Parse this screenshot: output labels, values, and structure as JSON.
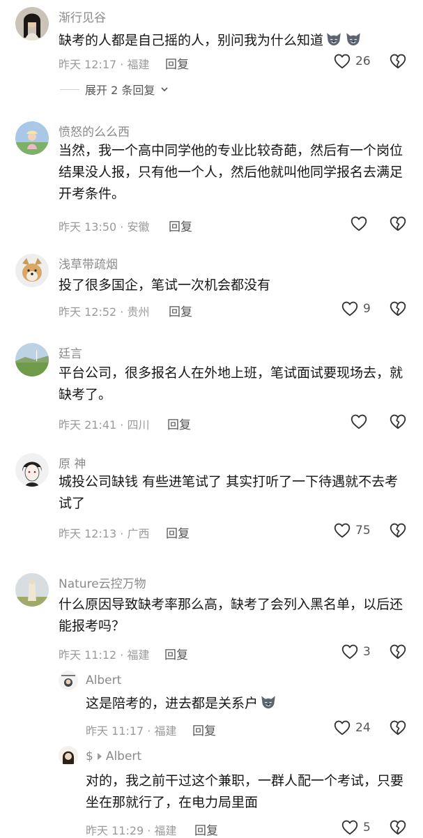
{
  "comments": [
    {
      "name": "渐行见谷",
      "text": "缺考的人都是自己摇的人，别问我为什么知道",
      "meta": "昨天 12:17 · 福建",
      "reply": "回复",
      "likes": "26",
      "expand": "展开 2 条回复"
    },
    {
      "name": "愤怒的么么西",
      "text": "当然，我一个高中同学他的专业比较奇葩，然后有一个岗位结果没人报，只有他一个人，然后他就叫他同学报名去满足开考条件。",
      "meta": "昨天 13:50 · 安徽",
      "reply": "回复",
      "likes": ""
    },
    {
      "name": "浅草带疏烟",
      "text": "投了很多国企，笔试一次机会都没有",
      "meta": "昨天 12:52 · 贵州",
      "reply": "回复",
      "likes": "9"
    },
    {
      "name": "廷言",
      "text": "平台公司，很多报名人在外地上班，笔试面试要现场去，就缺考了。",
      "meta": "昨天 21:41 · 四川",
      "reply": "回复",
      "likes": ""
    },
    {
      "name": "原 神",
      "text": "城投公司缺钱 有些进笔试了 其实打听了一下待遇就不去考试了",
      "meta": "昨天 12:13 · 广西",
      "reply": "回复",
      "likes": "75"
    },
    {
      "name": "Nature云控万物",
      "text": "什么原因导致缺考率那么高，缺考了会列入黑名单，以后还能报考吗？",
      "meta": "昨天 11:12 · 福建",
      "reply": "回复",
      "likes": "3"
    }
  ],
  "replies": [
    {
      "name": "Albert",
      "text": "这是陪考的，进去都是关系户",
      "meta": "昨天 11:17 · 福建",
      "reply": "回复",
      "likes": "24"
    },
    {
      "name": "$",
      "to": "Albert",
      "text": "对的，我之前干过这个兼职，一群人配一个考试，只要坐在那就行了，在电力局里面",
      "meta": "昨天 11:29 · 福建",
      "reply": "回复",
      "likes": "5"
    }
  ],
  "colors": {
    "name": "#8a8a8a",
    "text": "#161616",
    "meta": "#9a9a9a"
  }
}
